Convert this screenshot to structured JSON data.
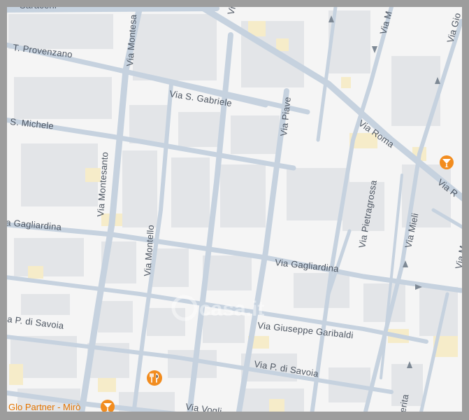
{
  "streets": {
    "saraceni": "Saraceni",
    "provenzano": "T. Provenzano",
    "montesanto_top": "Via Montesa",
    "montesanto": "Via Montesanto",
    "s_gabriele": "Via S. Gabriele",
    "s_michele": "S. Michele",
    "piave": "Via Piave",
    "roma": "Via Roma",
    "gagliardina_left": "a Gagliardina",
    "gagliardina": "Via Gagliardina",
    "montello": "Via Montello",
    "pietragrossa": "Via Pietragrossa",
    "mieli": "Via Mieli",
    "p_savoia_left": "a P. di Savoia",
    "p_savoia": "Via P. di Savoia",
    "garibaldi": "Via Giuseppe Garibaldi",
    "top_via_m": "Via M",
    "top_via_g": "Via Gio",
    "roma_right": "Via R",
    "via_ma": "Via Ma",
    "bottom_via": "Via Vogli",
    "bottom_erita": "erita",
    "top_via_v": "Vi"
  },
  "pois": {
    "glo_partner": "Glo Partner - Mirò"
  },
  "watermark": "casa.it",
  "colors": {
    "background": "#f5f5f5",
    "block": "#e3e5e8",
    "road": "#c6d2df",
    "label": "#4d5662",
    "poi": "#f28c1e"
  },
  "icons": {
    "poi_bar": "cocktail-icon",
    "poi_restaurant": "restaurant-icon"
  }
}
